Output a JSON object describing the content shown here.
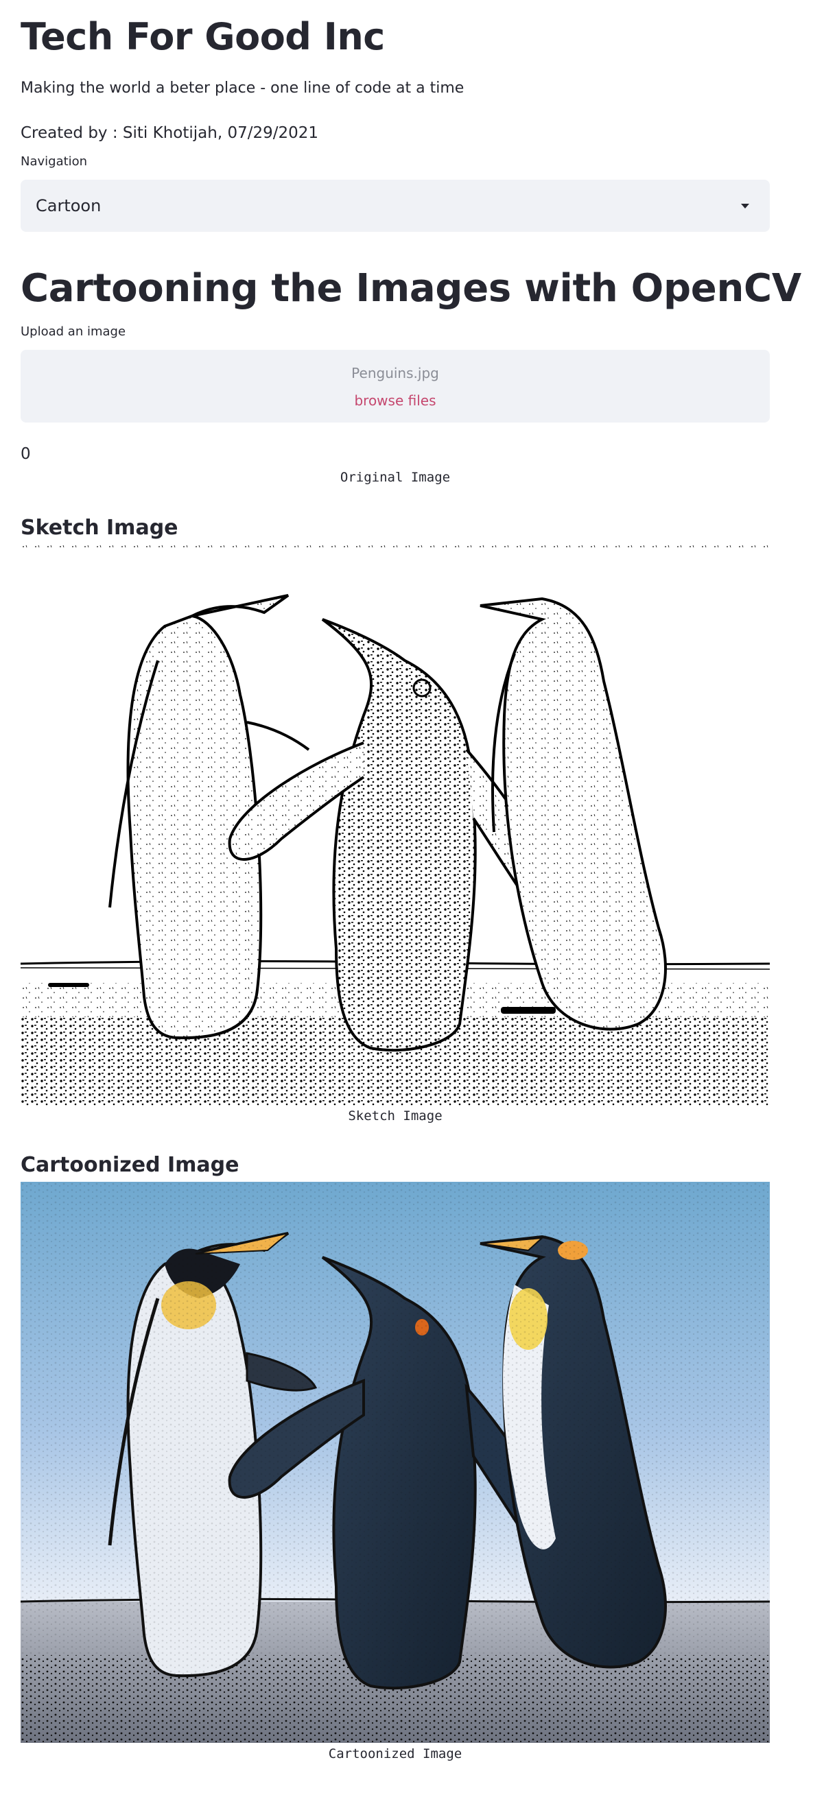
{
  "app": {
    "title": "Tech For Good Inc",
    "subtitle": "Making the world a beter place - one line of code at a time",
    "created_by": "Created by : Siti Khotijah, 07/29/2021"
  },
  "navigation": {
    "label": "Navigation",
    "selected": "Cartoon"
  },
  "page": {
    "heading": "Cartooning the Images with OpenCV",
    "upload_label": "Upload an image",
    "uploaded_file": "Penguins.jpg",
    "browse_label": "browse files",
    "value_output": "0",
    "original_caption": "Original Image"
  },
  "sketch": {
    "heading": "Sketch Image",
    "caption": "Sketch Image"
  },
  "cartoon": {
    "heading": "Cartoonized Image",
    "caption": "Cartoonized Image"
  },
  "colors": {
    "accent": "#c5476e",
    "text": "#262730",
    "widget_bg": "#f0f2f6"
  },
  "icons": {
    "select_caret": "caret-down-icon"
  }
}
